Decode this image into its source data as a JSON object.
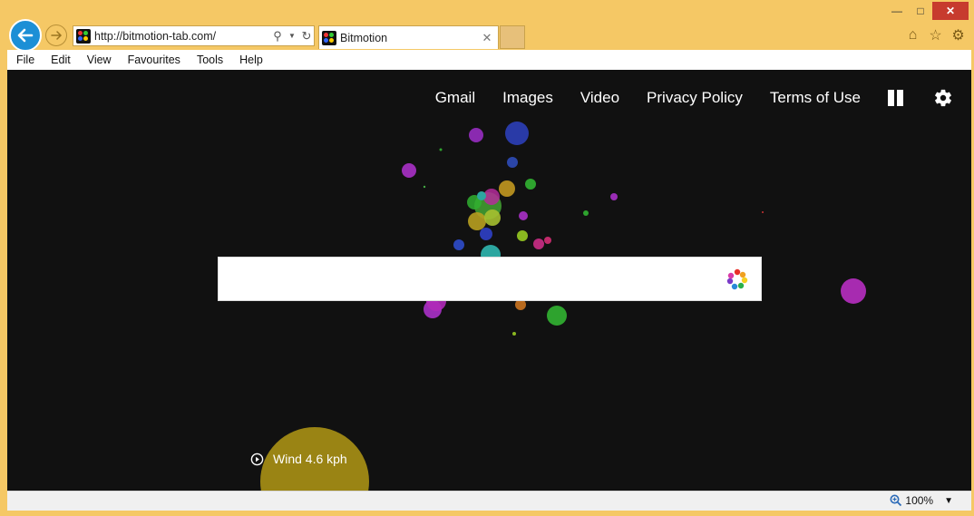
{
  "browser": {
    "url": "http://bitmotion-tab.com/",
    "tab_title": "Bitmotion",
    "menu": [
      "File",
      "Edit",
      "View",
      "Favourites",
      "Tools",
      "Help"
    ],
    "zoom": "100%"
  },
  "page": {
    "nav": [
      "Gmail",
      "Images",
      "Video",
      "Privacy Policy",
      "Terms of Use"
    ],
    "search_placeholder": "",
    "wind_text": "Wind 4.6 kph"
  },
  "colors": {
    "frame": "#f5c865",
    "page_bg": "#111111",
    "back_button": "#1c8fd6"
  }
}
